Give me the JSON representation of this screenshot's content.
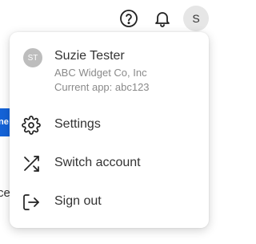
{
  "header": {
    "avatar_initial": "S",
    "help_icon": "help-circle-icon",
    "notifications_icon": "bell-icon"
  },
  "background": {
    "blue_tab_fragment": "ne",
    "text_fragment": "ce"
  },
  "account_menu": {
    "user": {
      "initials": "ST",
      "name": "Suzie Tester",
      "organization": "ABC Widget Co, Inc",
      "current_app": "Current app: abc123"
    },
    "items": [
      {
        "label": "Settings",
        "icon": "gear-icon"
      },
      {
        "label": "Switch account",
        "icon": "shuffle-icon"
      },
      {
        "label": "Sign out",
        "icon": "sign-out-icon"
      }
    ]
  },
  "colors": {
    "accent_blue": "#1463d8",
    "text_primary": "#333333",
    "text_secondary": "#8a8a8a",
    "avatar_gray": "#bdbdbd",
    "header_avatar_bg": "#e6e6e6"
  }
}
